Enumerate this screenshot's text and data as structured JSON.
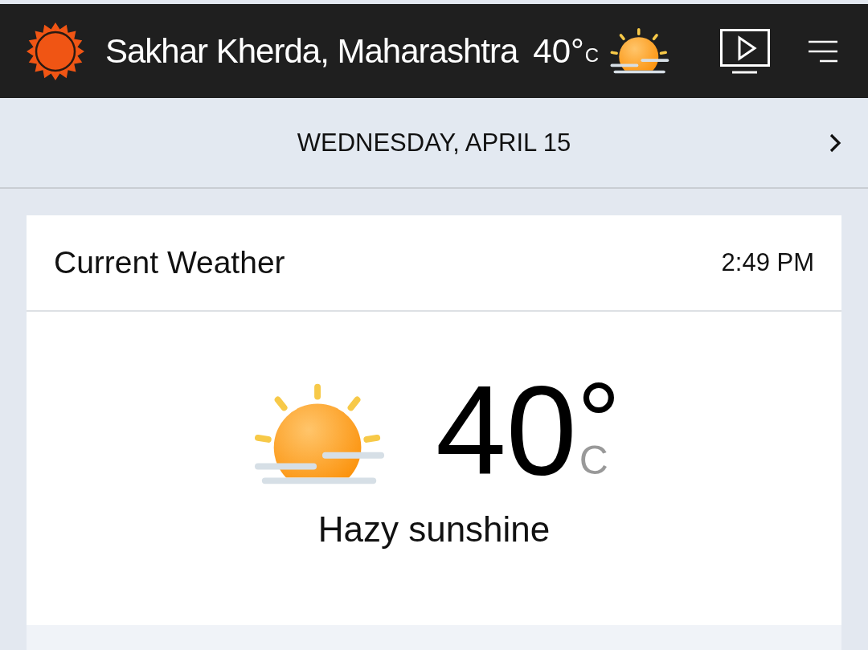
{
  "header": {
    "location": "Sakhar Kherda, Maharashtra",
    "temperature": "40°",
    "unit": "C"
  },
  "date_bar": {
    "date": "WEDNESDAY, APRIL 15"
  },
  "current_weather": {
    "title": "Current Weather",
    "time": "2:49 PM",
    "temperature": "40",
    "degree": "°",
    "unit": "C",
    "condition": "Hazy sunshine"
  }
}
